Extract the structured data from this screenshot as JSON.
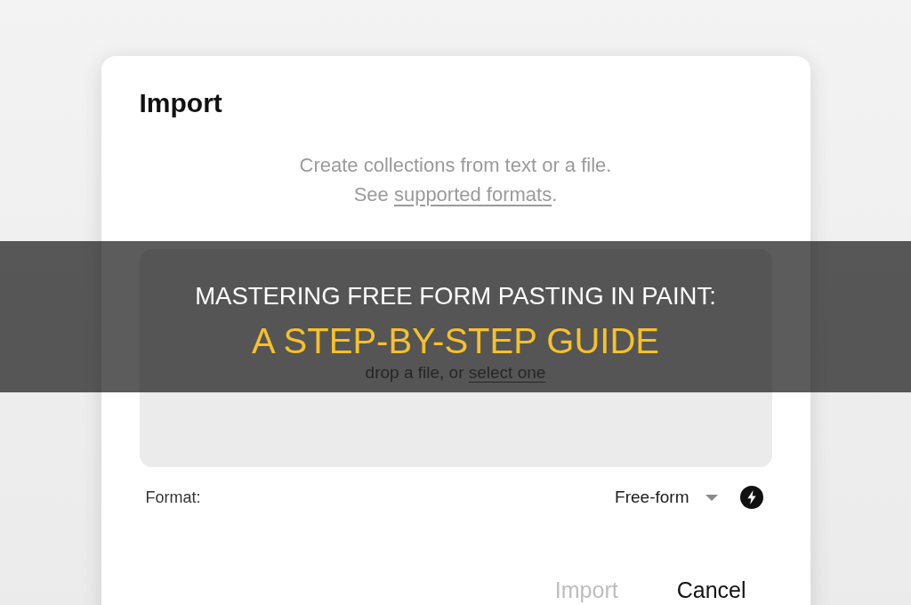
{
  "dialog": {
    "title": "Import",
    "description": {
      "line_1": "Create collections from text or a file.",
      "line_2": {
        "before": "See",
        "link": "supported formats",
        "after": "."
      }
    },
    "drop_zone": {
      "hint": "drop a file, or",
      "link": "select one"
    },
    "format": {
      "label": "Format:",
      "value": "Free-form"
    },
    "buttons": [
      {
        "label": "Import",
        "disabled": true
      },
      {
        "label": "Cancel",
        "disabled": false
      }
    ]
  },
  "title_banner": {
    "title": "MASTERING FREE FORM PASTING IN PAINT:",
    "subtitle": "A STEP-BY-STEP GUIDE"
  }
}
